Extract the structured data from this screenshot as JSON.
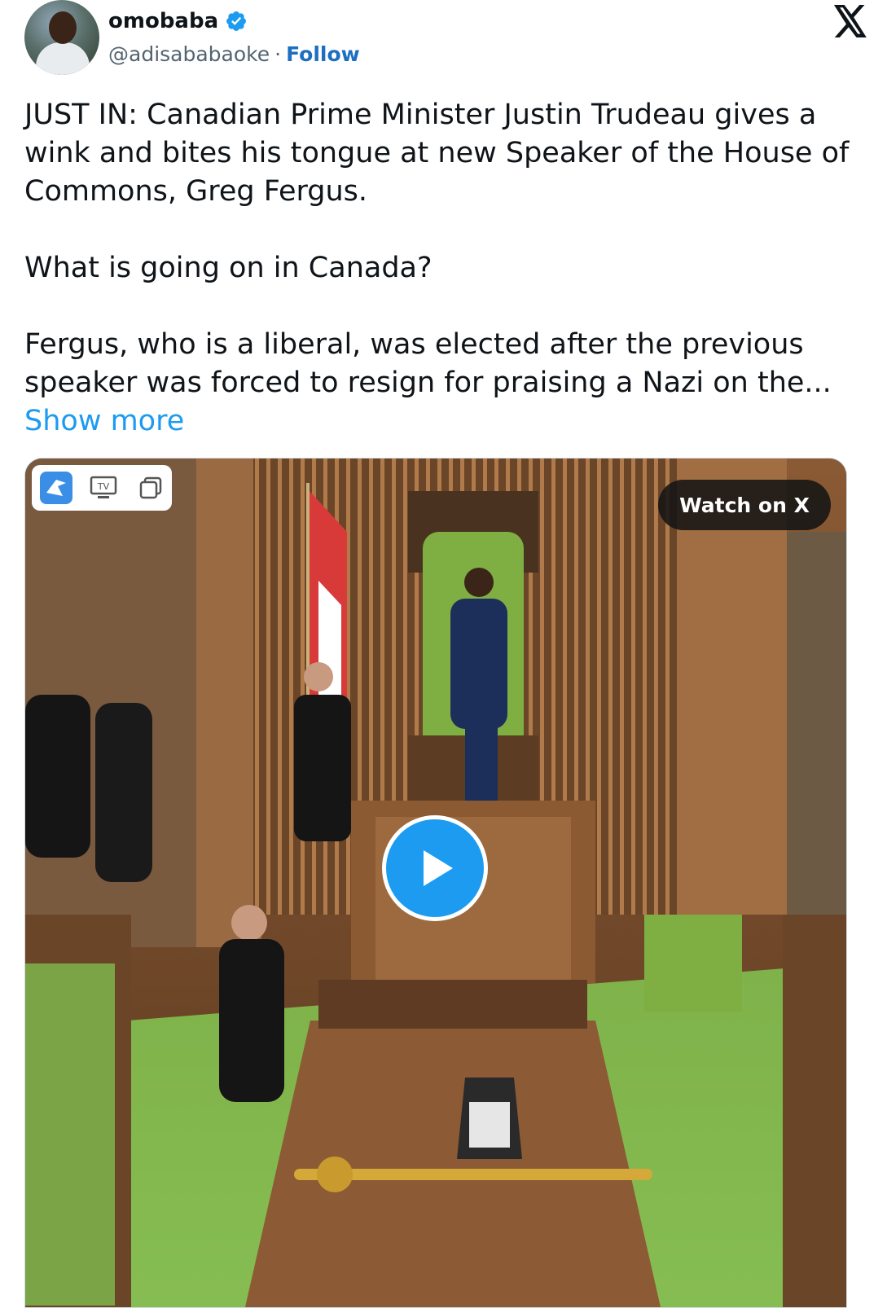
{
  "author": {
    "display_name": "omobaba",
    "handle": "@adisababaoke",
    "separator": "·",
    "follow_label": "Follow",
    "verified": true
  },
  "platform": {
    "logo_icon": "x-logo-icon"
  },
  "tweet": {
    "paragraph1": "JUST IN: Canadian Prime Minister Justin Trudeau gives a wink and bites his tongue at new Speaker of the House of Commons, Greg Fergus.",
    "paragraph2": "What is going on in Canada?",
    "paragraph3": "Fergus, who is a liberal, was elected after the previous speaker was forced to resign for praising a Nazi on the...",
    "show_more_label": "Show more"
  },
  "media": {
    "watch_label": "Watch on X",
    "toolbar_icons": [
      "bird-app-icon",
      "tv-icon",
      "copy-icon"
    ],
    "play_icon": "play-icon"
  },
  "colors": {
    "accent": "#1d9bf0",
    "follow": "#1d6fc2",
    "text": "#0f1419",
    "muted": "#536471"
  }
}
